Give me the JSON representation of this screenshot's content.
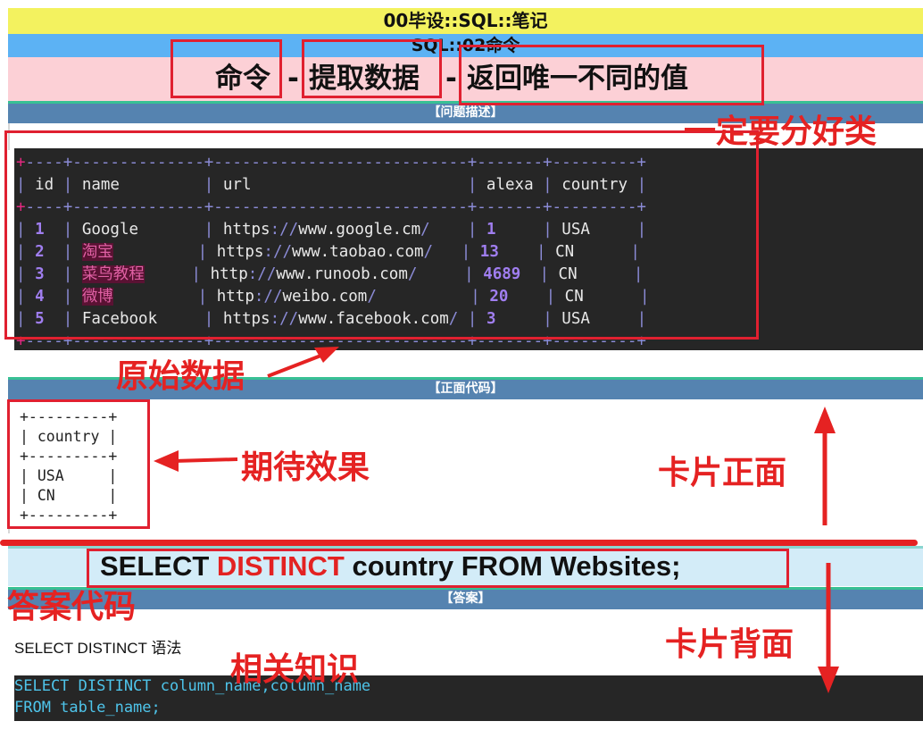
{
  "header": {
    "title_line1": "00毕设::SQL::笔记",
    "title_line2": "SQL::02命令",
    "big_part1": "命令",
    "big_sep1": "-",
    "big_part2": "提取数据",
    "big_sep2": "-",
    "big_part3": "返回唯一不同的值"
  },
  "sections": {
    "problem": "【问题描述】",
    "front_code": "【正面代码】",
    "answer": "【答案】"
  },
  "table": {
    "border_top": "+----+--------------+---------------------------+-------+---------+",
    "columns": [
      "id",
      "name",
      "url",
      "alexa",
      "country"
    ],
    "rows": [
      {
        "id": "1",
        "name": "Google",
        "url_a": "https",
        "url_b": "www.google.cm",
        "alexa": "1",
        "country": "USA"
      },
      {
        "id": "2",
        "name": "淘宝",
        "url_a": "https",
        "url_b": "www.taobao.com",
        "alexa": "13",
        "country": "CN"
      },
      {
        "id": "3",
        "name": "菜鸟教程",
        "url_a": "http",
        "url_b": "www.runoob.com",
        "alexa": "4689",
        "country": "CN"
      },
      {
        "id": "4",
        "name": "微博",
        "url_a": "http",
        "url_b": "weibo.com",
        "alexa": "20",
        "country": "CN"
      },
      {
        "id": "5",
        "name": "Facebook",
        "url_a": "https",
        "url_b": "www.facebook.com",
        "alexa": "3",
        "country": "USA"
      }
    ]
  },
  "expected": {
    "border": "+---------+",
    "header": "| country |",
    "row1": "| USA     |",
    "row2": "| CN      |"
  },
  "answer_code": {
    "kw1": "SELECT ",
    "kw2": "DISTINCT",
    "rest": " country FROM Websites;"
  },
  "knowledge": {
    "title": "SELECT DISTINCT 语法",
    "line1": "SELECT DISTINCT column_name,column_name",
    "line2": "FROM table_name;"
  },
  "annotations": {
    "classify": "一定要分好类",
    "raw_data": "原始数据",
    "expected_effect": "期待效果",
    "card_front": "卡片正面",
    "answer_code": "答案代码",
    "card_back": "卡片背面",
    "related": "相关知识"
  },
  "colors": {
    "annotation_red": "#e52222",
    "header_yellow": "#f3f25f",
    "header_blue": "#5cb2f4",
    "header_pink": "#fcd0d6",
    "section_blue": "#5583b0",
    "terminal_bg": "#262626"
  }
}
